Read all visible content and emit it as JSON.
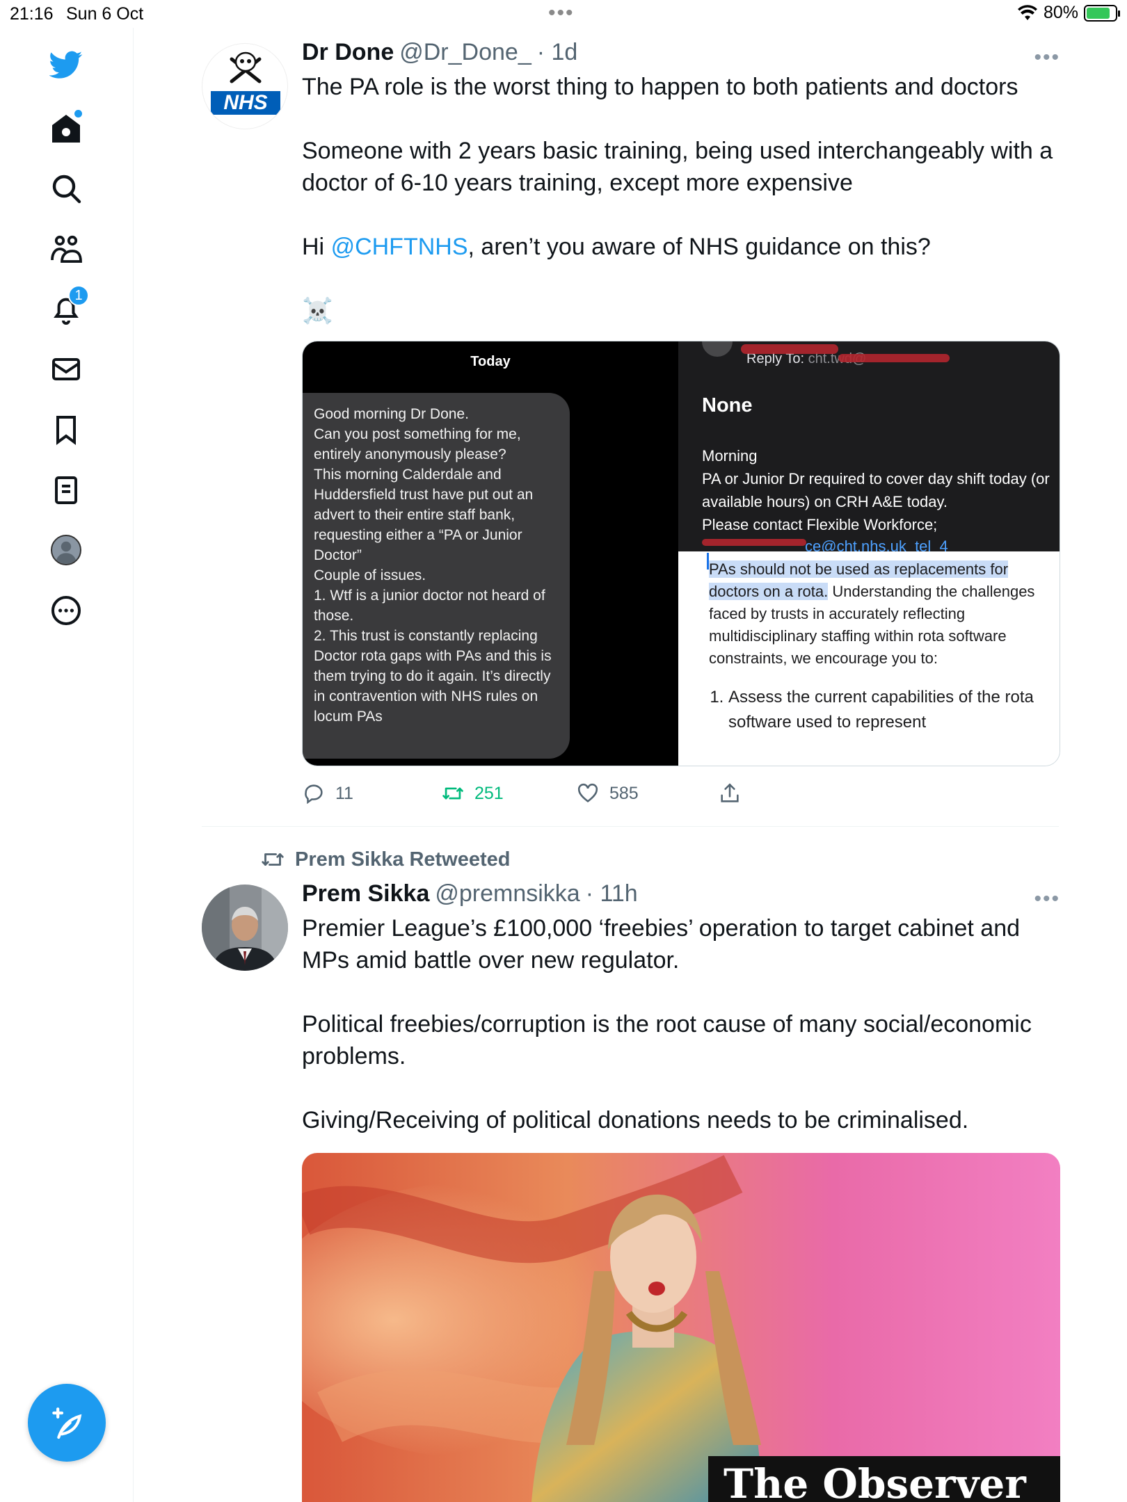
{
  "status_bar": {
    "time": "21:16",
    "date": "Sun 6 Oct",
    "battery": "80%",
    "battery_level": 0.8
  },
  "sidebar": {
    "notifications_badge": "1",
    "items": [
      {
        "name": "twitter-logo-icon"
      },
      {
        "name": "home-icon"
      },
      {
        "name": "search-icon"
      },
      {
        "name": "communities-icon"
      },
      {
        "name": "notifications-icon"
      },
      {
        "name": "messages-icon"
      },
      {
        "name": "bookmarks-icon"
      },
      {
        "name": "lists-icon"
      },
      {
        "name": "profile-icon"
      },
      {
        "name": "more-icon"
      }
    ]
  },
  "tweets": [
    {
      "name": "Dr Done",
      "handle": "@Dr_Done_",
      "time": "· 1d",
      "avatar_text": "NHS",
      "paragraphs": [
        "The PA role is the worst thing to happen to both patients and doctors",
        "Someone with 2 years basic training, being used interchangeably with a doctor of 6-10 years training, except more expensive"
      ],
      "mention_prefix": "Hi ",
      "mention": "@CHFTNHS",
      "mention_suffix": ", aren’t you aware of NHS guidance on this?",
      "emoji": "☠️",
      "media": {
        "left_header": "Today",
        "message": "Good morning Dr Done.\nCan you post something for me, entirely anonymously please?\nThis morning Calderdale and Huddersfield trust have put out an advert to their entire staff bank, requesting either a “PA or Junior Doctor”\nCouple of issues.\n1.  Wtf is a junior doctor not heard of those.\n2. This trust is constantly replacing Doctor rota gaps with PAs and this is them trying to do it again. It’s directly in contravention with NHS rules on locum PAs",
        "reply_to_label": "Reply To:",
        "reply_to_value": "cht.twd@",
        "subject": "None",
        "email_body": "Morning\nPA or Junior Dr required to cover day shift today (or available hours) on CRH A&E today.\nPlease contact Flexible Workforce;",
        "email_partial": "ce@cht.nhs.uk  tel  4",
        "doc_highlight": "PAs should not be used as replacements for doctors on a rota.",
        "doc_rest": " Understanding the challenges faced by trusts in accurately reflecting multidisciplinary staffing within rota software constraints, we encourage you to:",
        "doc_list_item": "Assess the current capabilities of the rota software used to represent"
      },
      "replies": "11",
      "retweets": "251",
      "likes": "585"
    },
    {
      "retweeted_by": "Prem Sikka Retweeted",
      "name": "Prem Sikka",
      "handle": "@premnsikka",
      "time": "· 11h",
      "paragraphs": [
        "Premier League’s £100,000 ‘freebies’ operation to target cabinet and MPs amid battle over new regulator.",
        "Political freebies/corruption is the root cause of many social/economic problems.",
        "Giving/Receiving of political donations needs to be criminalised."
      ],
      "photo_caption": "The Observer"
    }
  ],
  "colors": {
    "accent": "#1d9bf0",
    "retweet": "#00ba7c",
    "text_secondary": "#536471"
  }
}
